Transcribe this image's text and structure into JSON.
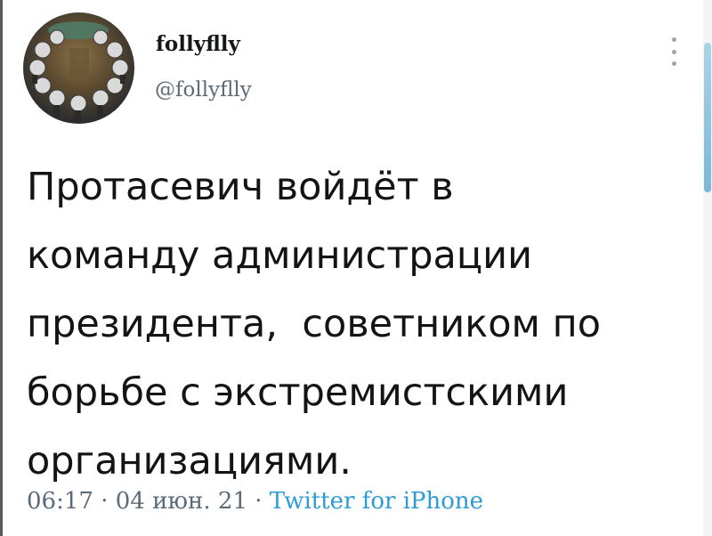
{
  "author": {
    "display_name": "follyflly",
    "handle": "@follyflly",
    "avatar_icon": "avatar-photo"
  },
  "tweet": {
    "lines": [
      "Протасевич войдёт в",
      "команду администрации",
      "президента,  советником по",
      "борьбе с экстремистскими",
      "организациями."
    ]
  },
  "meta": {
    "time": "06:17",
    "separator": " · ",
    "date": "04 июн. 21",
    "source": "Twitter for iPhone"
  },
  "colors": {
    "text": "#141414",
    "secondary": "#5b6a78",
    "link": "#2d9bd6"
  }
}
